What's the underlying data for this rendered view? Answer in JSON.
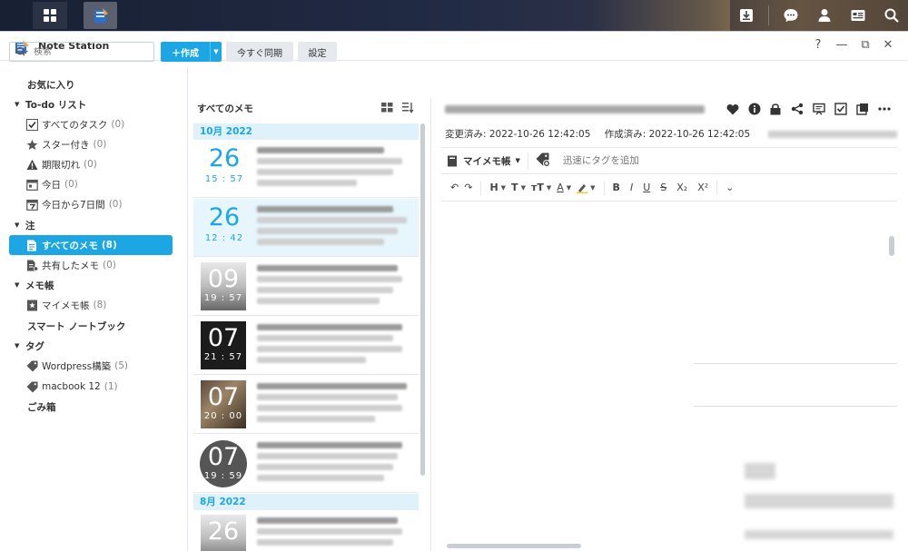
{
  "window": {
    "app_title": "Note Station",
    "controls": {
      "help": "?",
      "minimize": "—",
      "restore": "⧉",
      "close": "✕"
    }
  },
  "toolbar": {
    "search_placeholder": "検索",
    "create_label": "作成",
    "sync_label": "今すぐ同期",
    "settings_label": "設定"
  },
  "sidebar": {
    "favorites": "お気に入り",
    "todo": {
      "label": "To-do リスト",
      "items": [
        {
          "label": "すべてのタスク",
          "count": "(0)",
          "icon": "checkbox-icon"
        },
        {
          "label": "スター付き",
          "count": "(0)",
          "icon": "star-icon"
        },
        {
          "label": "期限切れ",
          "count": "(0)",
          "icon": "warning-icon"
        },
        {
          "label": "今日",
          "count": "(0)",
          "icon": "calendar-icon"
        },
        {
          "label": "今日から7日間",
          "count": "(0)",
          "icon": "calendar-7-icon"
        }
      ]
    },
    "notes": {
      "label": "注",
      "items": [
        {
          "label": "すべてのメモ",
          "count": "(8)",
          "icon": "notes-icon",
          "active": true
        },
        {
          "label": "共有したメモ",
          "count": "(0)",
          "icon": "shared-notes-icon"
        }
      ]
    },
    "notebooks": {
      "label": "メモ帳",
      "items": [
        {
          "label": "マイメモ帳",
          "count": "(8)",
          "icon": "notebook-icon"
        }
      ]
    },
    "smart_notebook": "スマート ノートブック",
    "tags": {
      "label": "タグ",
      "items": [
        {
          "label": "Wordpress構築",
          "count": "(5)",
          "icon": "tag-icon"
        },
        {
          "label": "macbook 12",
          "count": "(1)",
          "icon": "tag-icon"
        }
      ]
    },
    "trash": "ごみ箱"
  },
  "notelist": {
    "header": "すべてのメモ",
    "groups": [
      {
        "month": "10月 2022"
      },
      {
        "month": "8月 2022"
      }
    ],
    "notes": [
      {
        "day": "26",
        "time": "15 : 57",
        "style": "plain"
      },
      {
        "day": "26",
        "time": "12 : 42",
        "style": "plain",
        "selected": true
      },
      {
        "day": "09",
        "time": "19 : 57",
        "style": "thumb-light"
      },
      {
        "day": "07",
        "time": "21 : 57",
        "style": "thumb-dark"
      },
      {
        "day": "07",
        "time": "20 : 00",
        "style": "thumb-photo"
      },
      {
        "day": "07",
        "time": "19 : 59",
        "style": "round"
      },
      {
        "day": "26",
        "time": "",
        "style": "thumb-light"
      }
    ]
  },
  "editor": {
    "modified_label": "変更済み: 2022-10-26 12:42:05",
    "created_label": "作成済み: 2022-10-26 12:42:05",
    "notebook_label": "マイメモ帳",
    "tag_placeholder": "迅速にタグを追加",
    "format_buttons": [
      "H",
      "T",
      "ᴛT",
      "A",
      "B",
      "I",
      "U",
      "S",
      "X₂",
      "X²"
    ]
  },
  "colors": {
    "accent": "#1ca6e4",
    "selected_bg": "#e7f6fd",
    "month_bg": "#dff1fb"
  }
}
